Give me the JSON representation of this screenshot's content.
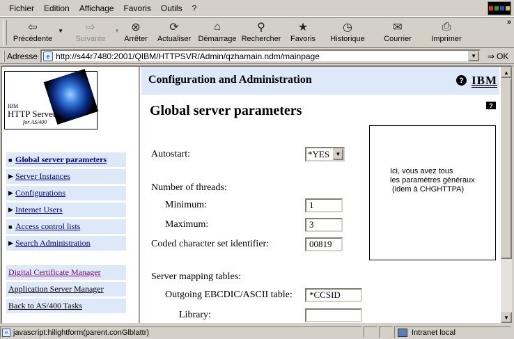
{
  "menu": {
    "items": [
      {
        "label": "Fichier"
      },
      {
        "label": "Edition"
      },
      {
        "label": "Affichage"
      },
      {
        "label": "Favoris"
      },
      {
        "label": "Outils"
      },
      {
        "label": "?"
      }
    ]
  },
  "toolbar": {
    "back": "Précédente",
    "forward": "Suivante",
    "stop": "Arrêter",
    "refresh": "Actualiser",
    "home": "Démarrage",
    "search": "Rechercher",
    "favorites": "Favoris",
    "history": "Historique",
    "mail": "Courrier",
    "print": "Imprimer",
    "more": "»"
  },
  "address": {
    "label": "Adresse",
    "url": "http://s44r7480:2001/QIBM/HTTPSVR/Admin/qzhamain.ndm/mainpage",
    "go": "OK"
  },
  "logo": {
    "line1": "IBM",
    "line2": "HTTP Server",
    "line3": "for AS/400"
  },
  "nav": {
    "items": [
      {
        "label": "Global server parameters",
        "marker": "■"
      },
      {
        "label": "Server Instances",
        "marker": "▶"
      },
      {
        "label": "Configurations",
        "marker": "▶"
      },
      {
        "label": "Internet Users",
        "marker": "▶"
      },
      {
        "label": "Access control lists",
        "marker": "■"
      },
      {
        "label": "Search Administration",
        "marker": "▶"
      }
    ],
    "links": [
      {
        "label": "Digital Certificate Manager"
      },
      {
        "label": "Application Server Manager"
      },
      {
        "label": "Back to AS/400 Tasks"
      }
    ]
  },
  "header": {
    "title": "Configuration and Administration",
    "help": "?",
    "brand": "IBM"
  },
  "main": {
    "page_title": "Global server parameters",
    "help_small": "?",
    "autostart_label": "Autostart:",
    "autostart_value": "*YES",
    "threads_label": "Number of threads:",
    "min_label": "Minimum:",
    "min_value": "1",
    "max_label": "Maximum:",
    "max_value": "3",
    "ccsid_label": "Coded character set identifier:",
    "ccsid_value": "00819",
    "mapping_label": "Server mapping tables:",
    "outgoing_label": "Outgoing EBCDIC/ASCII table:",
    "outgoing_value": "*CCSID",
    "library_label": "Library:",
    "library_value": "",
    "info_text": "Ici, vous avez tous\nles paramètres généraux\n (idem à CHGHTTPA)"
  },
  "status": {
    "text": "javascript:hilightform(parent.conGlblattr)",
    "zone": "Intranet local"
  }
}
